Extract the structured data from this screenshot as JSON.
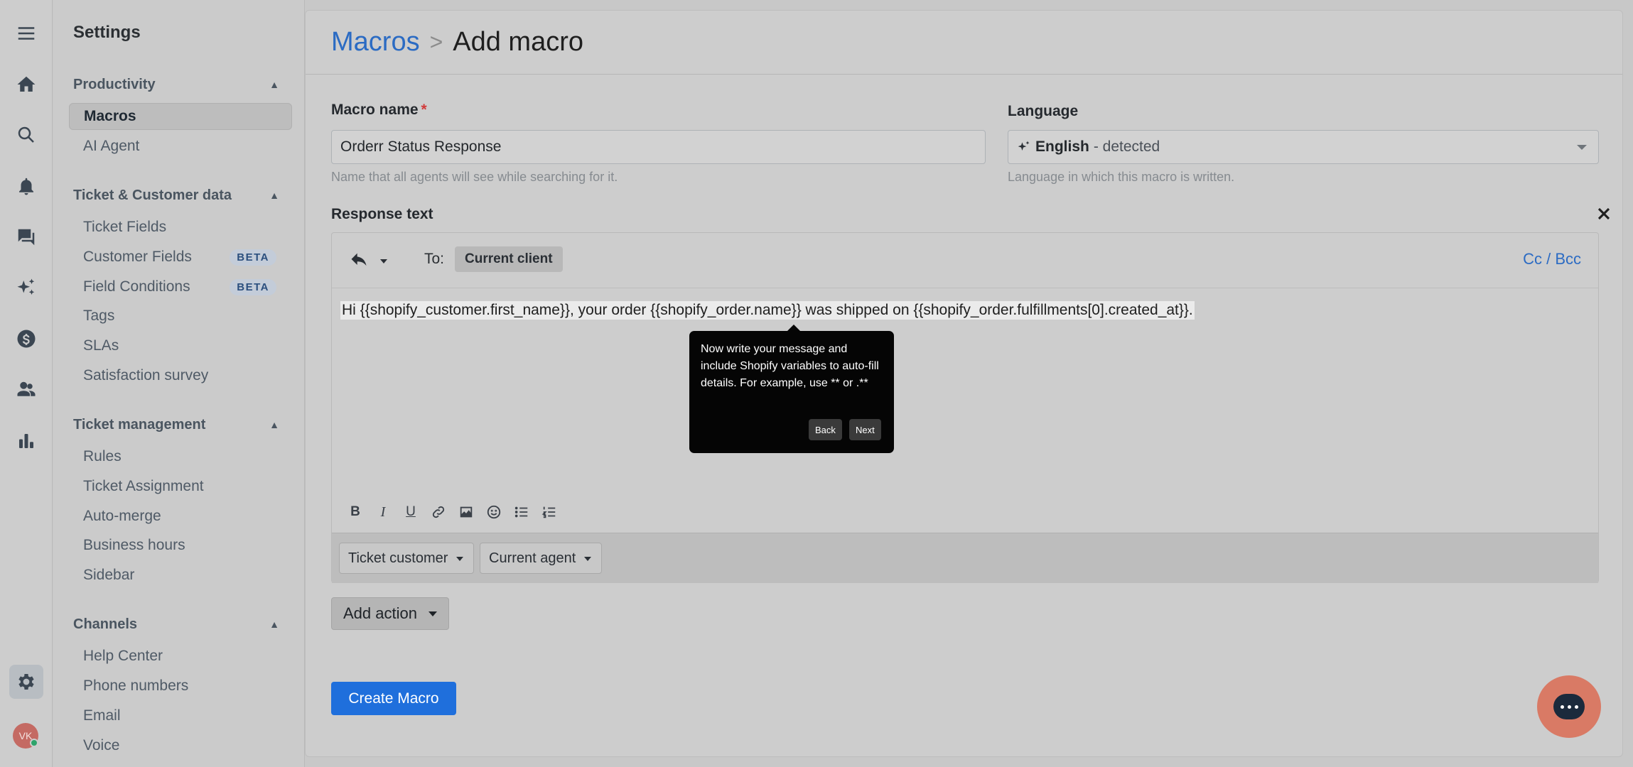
{
  "rail": {
    "icons": [
      "menu-icon",
      "home-icon",
      "search-icon",
      "bell-icon",
      "chat-icon",
      "sparkle-icon",
      "dollar-icon",
      "users-icon",
      "bar-chart-icon",
      "gear-icon"
    ],
    "avatar_initials": "VK"
  },
  "sidebar": {
    "title": "Settings",
    "sections": [
      {
        "label": "Productivity",
        "items": [
          "Macros",
          "AI Agent"
        ]
      },
      {
        "label": "Ticket & Customer data",
        "items": [
          "Ticket Fields",
          "Customer Fields",
          "Field Conditions",
          "Tags",
          "SLAs",
          "Satisfaction survey"
        ]
      },
      {
        "label": "Ticket management",
        "items": [
          "Rules",
          "Ticket Assignment",
          "Auto-merge",
          "Business hours",
          "Sidebar"
        ]
      },
      {
        "label": "Channels",
        "items": [
          "Help Center",
          "Phone numbers",
          "Email",
          "Voice"
        ]
      }
    ],
    "beta_label": "BETA",
    "active_item": "Macros"
  },
  "header": {
    "crumb_link": "Macros",
    "crumb_sep": ">",
    "crumb_current": "Add macro"
  },
  "form": {
    "macro_name_label": "Macro name",
    "required_mark": "*",
    "macro_name_value": "Orderr Status Response",
    "macro_name_hint": "Name that all agents will see while searching for it.",
    "language_label": "Language",
    "language_value": "English",
    "language_detected": "- detected",
    "language_hint": "Language in which this macro is written.",
    "response_label": "Response text"
  },
  "editor": {
    "to_label": "To:",
    "to_chip": "Current client",
    "cc_bcc": "Cc / Bcc",
    "body": "Hi {{shopify_customer.first_name}}, your order {{shopify_order.name}} was shipped on {{shopify_order.fulfillments[0].created_at}}.",
    "toolbar": [
      "bold-icon",
      "italic-icon",
      "underline-icon",
      "link-icon",
      "image-icon",
      "emoji-icon",
      "bullet-list-icon",
      "numbered-list-icon"
    ],
    "var_buttons": [
      "Ticket customer",
      "Current agent"
    ]
  },
  "tooltip": {
    "text": "Now write your message and include Shopify variables to auto-fill details. For example, use ** or .**",
    "back": "Back",
    "next": "Next"
  },
  "actions": {
    "add_action": "Add action",
    "create": "Create Macro"
  },
  "colors": {
    "accent": "#1f6fdc",
    "link": "#2b6bc3",
    "required": "#d13b3b",
    "chat_fab": "#d97a65"
  }
}
